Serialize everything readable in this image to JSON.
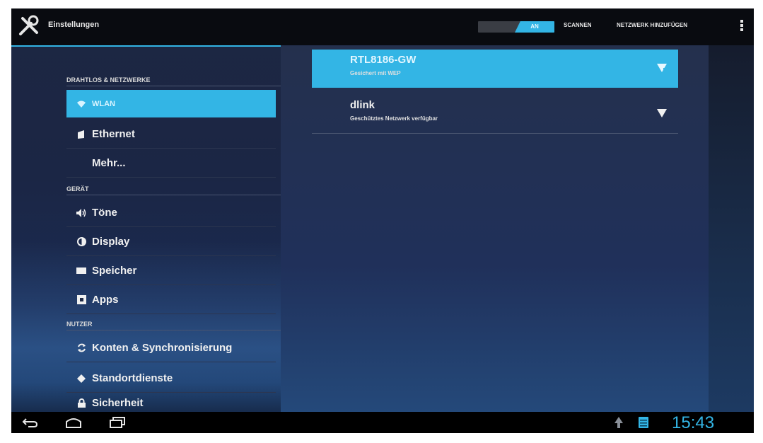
{
  "action_bar": {
    "title": "Einstellungen",
    "wifi_toggle": "AN",
    "scan": "SCANNEN",
    "add_network": "NETZWERK HINZUFÜGEN"
  },
  "sidebar": {
    "wireless_header": "DRAHTLOS & NETZWERKE",
    "wlan": "WLAN",
    "ethernet": "Ethernet",
    "more": "Mehr...",
    "device_header": "GERÄT",
    "sounds": "Töne",
    "display": "Display",
    "storage": "Speicher",
    "apps": "Apps",
    "user_header": "NUTZER",
    "accounts": "Konten & Synchronisierung",
    "location": "Standortdienste",
    "security": "Sicherheit"
  },
  "networks": [
    {
      "ssid": "RTL8186-GW",
      "status": "Gesichert mit WEP"
    },
    {
      "ssid": "dlink",
      "status": "Geschütztes Netzwerk verfügbar"
    }
  ],
  "status_bar": {
    "clock": "15:43"
  },
  "colors": {
    "accent": "#33b5e5",
    "background": "#1b2645"
  }
}
